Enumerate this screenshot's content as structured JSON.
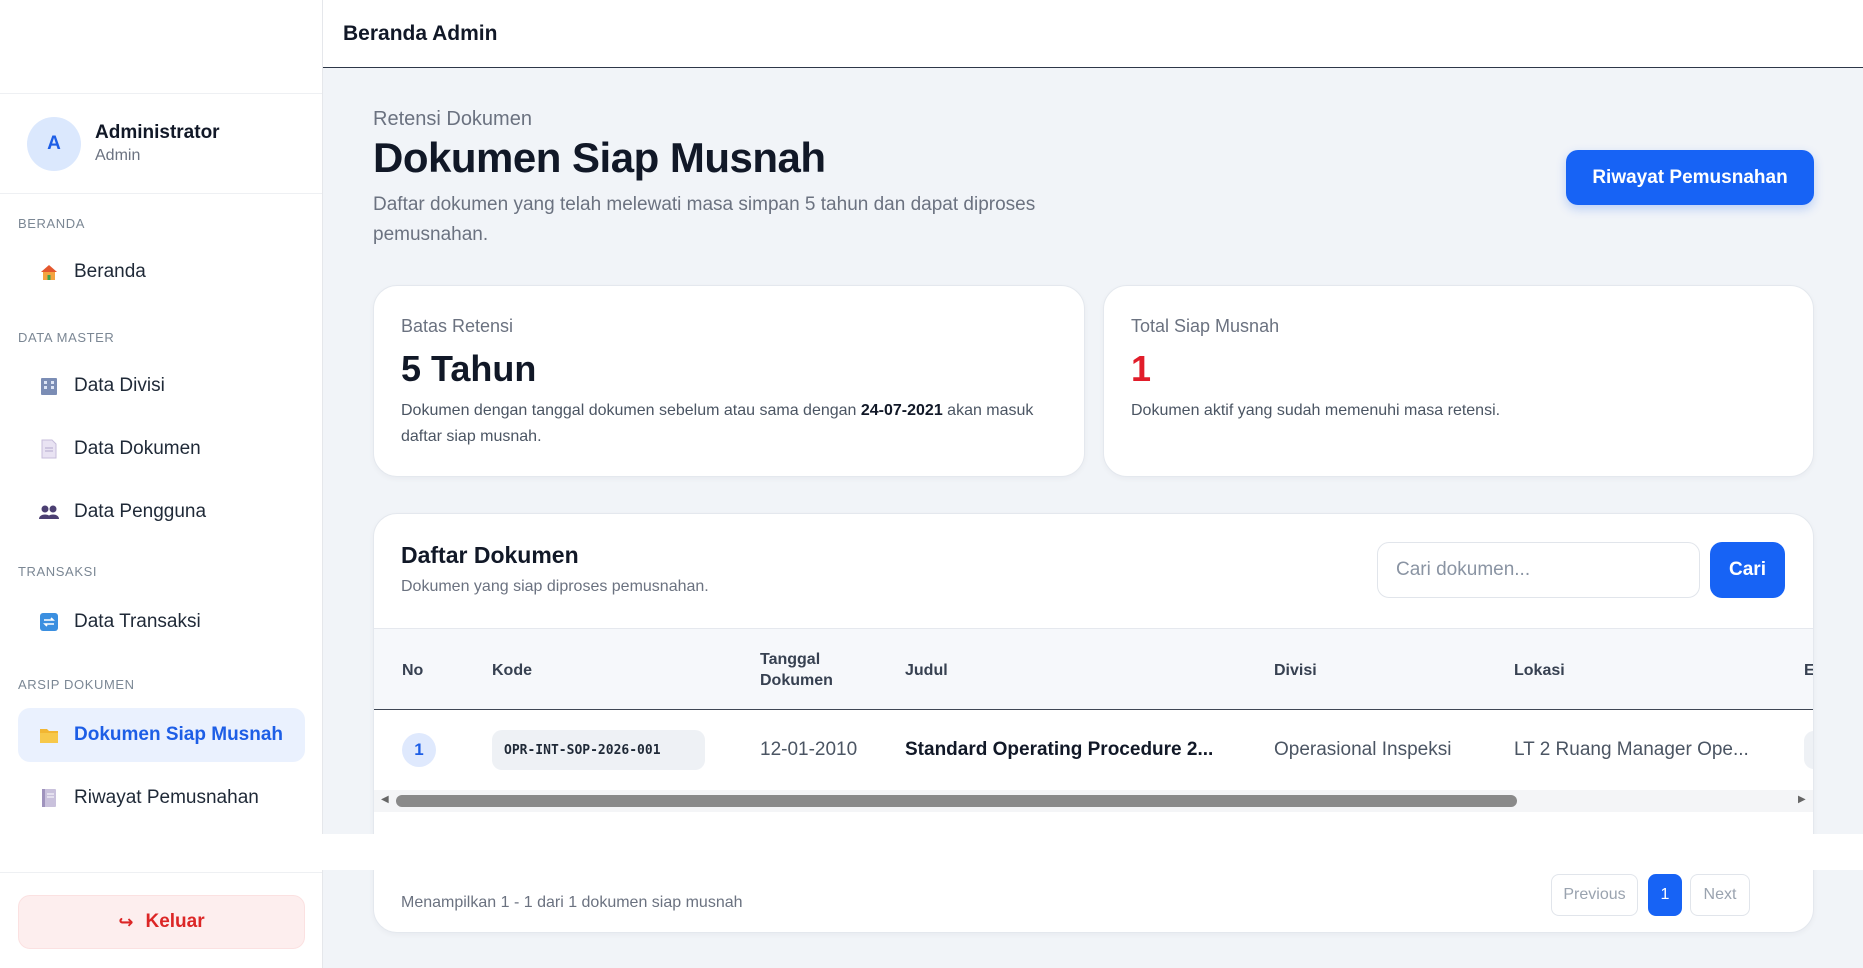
{
  "topbar": {
    "title": "Beranda Admin"
  },
  "user": {
    "initial": "A",
    "name": "Administrator",
    "role": "Admin"
  },
  "sidebar": {
    "sections": [
      {
        "label": "BERANDA",
        "items": [
          {
            "label": "Beranda",
            "icon": "home-icon"
          }
        ]
      },
      {
        "label": "DATA MASTER",
        "items": [
          {
            "label": "Data Divisi",
            "icon": "building-icon"
          },
          {
            "label": "Data Dokumen",
            "icon": "document-icon"
          },
          {
            "label": "Data Pengguna",
            "icon": "users-icon"
          }
        ]
      },
      {
        "label": "TRANSAKSI",
        "items": [
          {
            "label": "Data Transaksi",
            "icon": "transfer-icon"
          }
        ]
      },
      {
        "label": "ARSIP DOKUMEN",
        "items": [
          {
            "label": "Dokumen Siap Musnah",
            "icon": "folder-icon",
            "active": true
          },
          {
            "label": "Riwayat Pemusnahan",
            "icon": "ledger-icon"
          }
        ]
      }
    ],
    "logout_label": "Keluar"
  },
  "header": {
    "eyebrow": "Retensi Dokumen",
    "title": "Dokumen Siap Musnah",
    "description": "Daftar dokumen yang telah melewati masa simpan 5 tahun dan dapat diproses pemusnahan.",
    "history_button": "Riwayat Pemusnahan"
  },
  "stats": {
    "retention": {
      "label": "Batas Retensi",
      "value": "5 Tahun",
      "note_before": "Dokumen dengan tanggal dokumen sebelum atau sama dengan ",
      "note_date": "24-07-2021",
      "note_after": " akan masuk daftar siap musnah."
    },
    "total": {
      "label": "Total Siap Musnah",
      "value": "1",
      "note": "Dokumen aktif yang sudah memenuhi masa retensi."
    }
  },
  "table": {
    "title": "Daftar Dokumen",
    "subtitle": "Dokumen yang siap diproses pemusnahan.",
    "search_placeholder": "Cari dokumen...",
    "search_button": "Cari",
    "columns": {
      "no": "No",
      "kode": "Kode",
      "tanggal_line1": "Tanggal",
      "tanggal_line2": "Dokumen",
      "judul": "Judul",
      "divisi": "Divisi",
      "lokasi": "Lokasi",
      "next_partial": "E"
    },
    "rows": [
      {
        "no": "1",
        "kode": "OPR-INT-SOP-2026-001",
        "tanggal": "12-01-2010",
        "judul": "Standard Operating Procedure 2...",
        "divisi": "Operasional Inspeksi",
        "lokasi": "LT 2 Ruang Manager Ope..."
      }
    ],
    "footer_text": "Menampilkan 1 - 1 dari 1 dokumen siap musnah",
    "pagination": {
      "previous": "Previous",
      "current": "1",
      "next": "Next"
    }
  },
  "colors": {
    "accent": "#1763f5",
    "danger": "#e11d2a",
    "background": "#f1f4f8"
  }
}
